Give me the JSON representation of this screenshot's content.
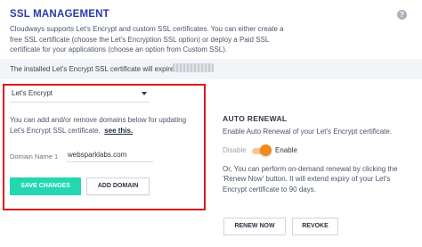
{
  "header": {
    "title": "SSL MANAGEMENT",
    "help_icon": "question-circle-icon",
    "description": "Cloudways supports Let's Encrypt and custom SSL certificates. You can either create a free SSL certificate (choose the Let's Encryption SSL option) or deploy a Paid SSL certificate for your applications (choose an option from Custom SSL)."
  },
  "banner": {
    "text": "The installed Let's Encrypt SSL certificate will expire on"
  },
  "certificate_form": {
    "select_value": "Let's Encrypt",
    "info_text": "You can add and/or remove domains below for updating Let's Encrypt SSL certificate.",
    "see_this_link": "see this.",
    "domain_label": "Domain Name 1",
    "domain_value": "websparklabs.com",
    "save_label": "SAVE CHANGES",
    "add_domain_label": "ADD DOMAIN",
    "highlight_color": "#e0161b",
    "accent_color": "#23d7b1"
  },
  "auto_renewal": {
    "title": "AUTO RENEWAL",
    "description": "Enable Auto Renewal of your Let's Encrypt certificate.",
    "disable_label": "Disable",
    "enable_label": "Enable",
    "toggle_state": "enabled",
    "toggle_color": "#f08a1c",
    "on_demand_text": "Or, You can perform on-demand renewal by clicking the 'Renew Now' button. It will extend expiry of your Let's Encrypt certificate to 90 days.",
    "renew_label": "RENEW NOW",
    "revoke_label": "REVOKE"
  }
}
